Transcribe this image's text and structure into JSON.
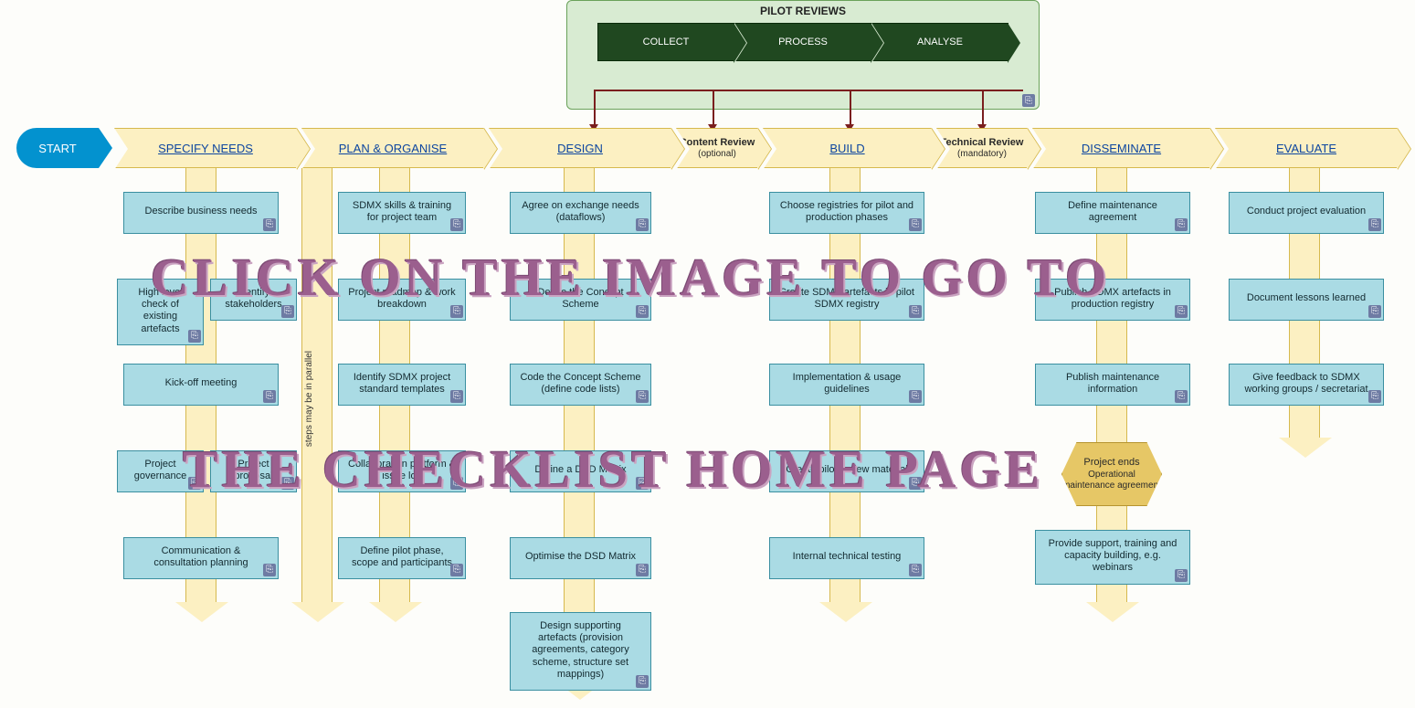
{
  "pilot": {
    "title": "PILOT REVIEWS",
    "steps": [
      "COLLECT",
      "PROCESS",
      "ANALYSE"
    ]
  },
  "start": "START",
  "phases": {
    "specify": "SPECIFY NEEDS",
    "plan": "PLAN & ORGANISE",
    "design": "DESIGN",
    "content_review_l1": "Content Review",
    "content_review_l2": "(optional)",
    "build": "BUILD",
    "tech_review_l1": "Technical Review",
    "tech_review_l2": "(mandatory)",
    "disseminate": "DISSEMINATE",
    "evaluate": "EVALUATE"
  },
  "lane_note": "steps may be in parallel",
  "tasks": {
    "specify": [
      "Describe business needs",
      "High level check of existing artefacts",
      "Identify stakeholders",
      "Kick-off meeting",
      "Project governance",
      "Project proposal",
      "Communication & consultation planning"
    ],
    "plan": [
      "SDMX skills & training for project team",
      "Project roadmap & work breakdown",
      "Identify SDMX project standard templates",
      "Collaboration platform & issue log",
      "Define pilot phase, scope and participants"
    ],
    "design": [
      "Agree on exchange needs (dataflows)",
      "Define the Concept Scheme",
      "Code the Concept Scheme (define code lists)",
      "Define a DSD Matrix",
      "Optimise the DSD Matrix",
      "Design supporting artefacts (provision agreements, category scheme, structure set mappings)"
    ],
    "build": [
      "Choose registries for pilot and production phases",
      "Create SDMX artefacts in pilot SDMX registry",
      "Implementation & usage guidelines",
      "Create pilot review material",
      "Internal technical testing"
    ],
    "disseminate": [
      "Define maintenance agreement",
      "Publish SDMX artefacts in production registry",
      "Publish maintenance information",
      "Provide support, training and capacity building, e.g. webinars"
    ],
    "evaluate": [
      "Conduct project evaluation",
      "Document lessons learned",
      "Give feedback to SDMX working groups / secretariat"
    ]
  },
  "project_end": {
    "l1": "Project ends",
    "l2": "Operational maintenance agreement"
  },
  "overlay": {
    "line1": "CLICK ON THE IMAGE TO GO TO",
    "line2": "THE CHECKLIST HOME PAGE"
  }
}
